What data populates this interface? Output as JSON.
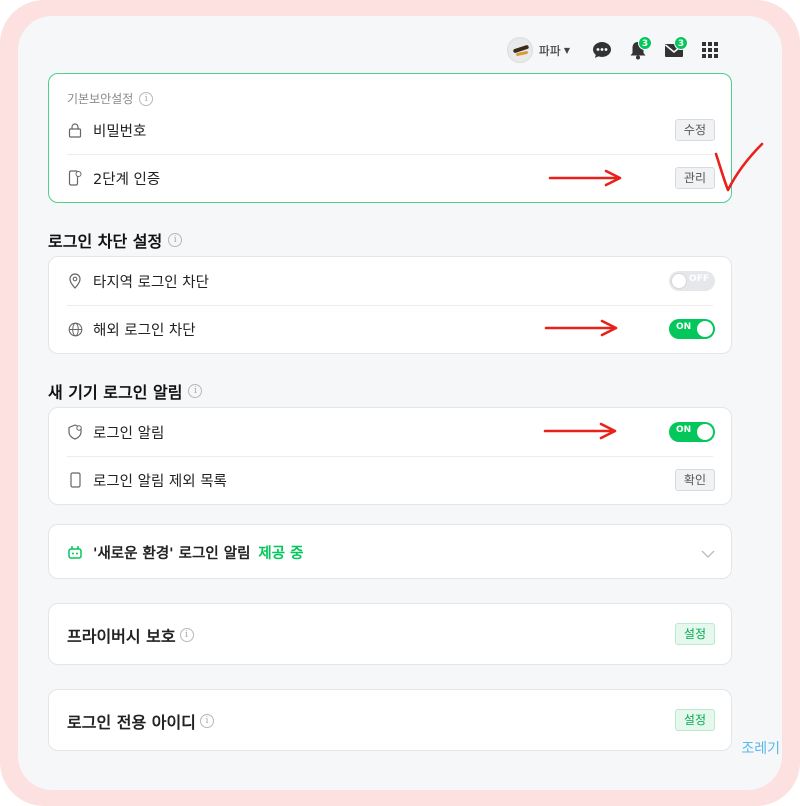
{
  "header": {
    "username": "파파",
    "chat_badge": null,
    "notification_count": "3",
    "mail_count": "3"
  },
  "basic_security": {
    "title": "기본보안설정",
    "password_label": "비밀번호",
    "password_button": "수정",
    "two_factor_label": "2단계 인증",
    "two_factor_button": "관리"
  },
  "login_block": {
    "title": "로그인 차단 설정",
    "region_block_label": "타지역 로그인 차단",
    "region_block_state": "OFF",
    "overseas_block_label": "해외 로그인 차단",
    "overseas_block_state": "ON"
  },
  "new_device_alert": {
    "title": "새 기기 로그인 알림",
    "login_alert_label": "로그인 알림",
    "login_alert_state": "ON",
    "exclude_list_label": "로그인 알림 제외 목록",
    "exclude_list_button": "확인"
  },
  "new_env": {
    "label": "'새로운 환경' 로그인 알림",
    "status": "제공 중"
  },
  "privacy": {
    "title": "프라이버시 보호",
    "button": "설정"
  },
  "login_only_id": {
    "title": "로그인 전용 아이디",
    "button": "설정"
  },
  "watermark": "조레기",
  "colors": {
    "accent_green": "#03c75a",
    "annotation_red": "#e8221b",
    "frame_pink": "#fde0e0"
  }
}
